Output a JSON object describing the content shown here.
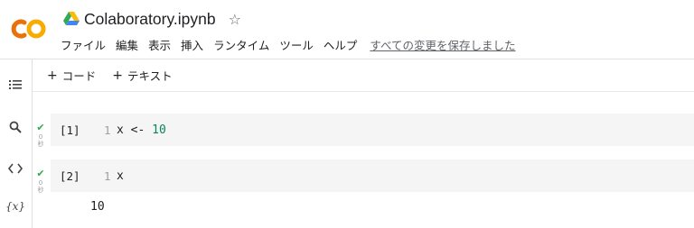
{
  "header": {
    "title": "Colaboratory.ipynb",
    "logo_colors": {
      "orange": "#F9AB00",
      "dark_orange": "#E8710A"
    },
    "menu": [
      "ファイル",
      "編集",
      "表示",
      "挿入",
      "ランタイム",
      "ツール",
      "ヘルプ"
    ],
    "save_status": "すべての変更を保存しました"
  },
  "toolbar": {
    "add_code_label": "コード",
    "add_text_label": "テキスト"
  },
  "sidebar": {
    "items": [
      "table-of-contents-icon",
      "search-icon",
      "code-snippets-icon",
      "variables-icon"
    ],
    "variables_glyph": "{x}"
  },
  "cells": [
    {
      "exec_label": "[1]",
      "line_no": "1",
      "code_pre": "x <- ",
      "code_num": "10",
      "status_seconds": "0",
      "status_unit": "秒"
    },
    {
      "exec_label": "[2]",
      "line_no": "1",
      "code_pre": "x",
      "code_num": "",
      "status_seconds": "0",
      "status_unit": "秒",
      "output": "10"
    }
  ]
}
